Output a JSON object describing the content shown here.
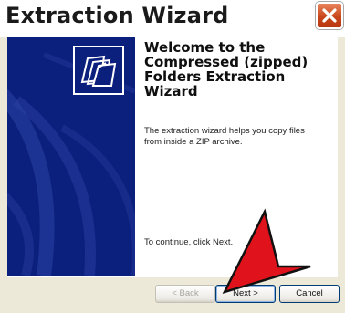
{
  "window": {
    "title": "Extraction Wizard",
    "close_icon": "close-icon"
  },
  "side_panel": {
    "icon": "folders-icon"
  },
  "main": {
    "heading_line1": "Welcome to the",
    "heading_line2": "Compressed (zipped)",
    "heading_line3": "Folders Extraction",
    "heading_line4": "Wizard",
    "description_line1": "The extraction wizard helps you copy files",
    "description_line2": "from inside a ZIP archive.",
    "continue_text": "To continue, click Next."
  },
  "buttons": {
    "back_label": "< Back",
    "next_label": "Next >",
    "cancel_label": "Cancel"
  },
  "annotation": {
    "pointer_icon": "red-arrow-icon",
    "color": "#e0121b"
  },
  "colors": {
    "side_panel": "#0b1f7c",
    "close_button": "#c9461b",
    "dialog_background": "#ece9d8"
  }
}
